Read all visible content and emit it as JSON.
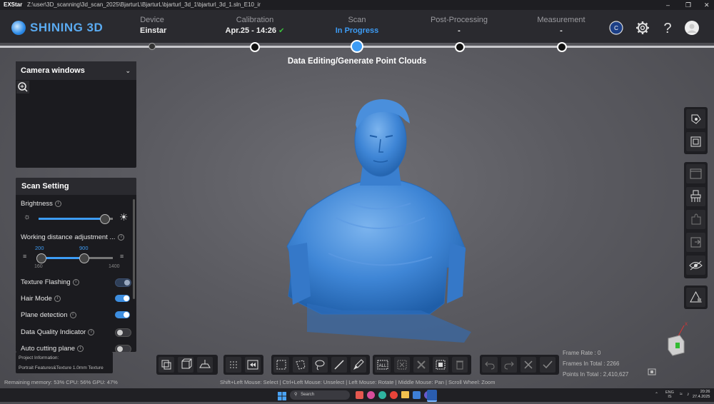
{
  "titlebar": {
    "app": "EXStar",
    "path": "Z:\\user\\3D_scanning\\3d_scan_2025\\BjarturL\\BjarturL\\bjarturl_3d_1\\bjarturl_3d_1.sln_E10_ir"
  },
  "brand": {
    "name": "SHINING 3D",
    "color": "#5aaaf0"
  },
  "steps": [
    {
      "label": "Device",
      "value": "Einstar"
    },
    {
      "label": "Calibration",
      "value": "Apr.25 - 14:26"
    },
    {
      "label": "Scan",
      "value": "In Progress"
    },
    {
      "label": "Post-Processing",
      "value": "-"
    },
    {
      "label": "Measurement",
      "value": "-"
    }
  ],
  "banner": "Data Editing/Generate Point Clouds",
  "camera_windows": {
    "title": "Camera windows"
  },
  "scan_setting": {
    "title": "Scan Setting",
    "brightness_label": "Brightness",
    "brightness_level": 0.88,
    "working_distance_label": "Working distance adjustment ...",
    "wd_low": "200",
    "wd_high": "900",
    "wd_min": "160",
    "wd_max": "1400",
    "texture_flashing": {
      "label": "Texture Flashing",
      "on": false
    },
    "hair_mode": {
      "label": "Hair Mode",
      "on": true
    },
    "plane_detection": {
      "label": "Plane detection",
      "on": true
    },
    "data_quality": {
      "label": "Data Quality Indicator",
      "on": false
    },
    "auto_cutting": {
      "label": "Auto cutting plane",
      "on": false
    }
  },
  "project_info": {
    "title": "Project Information:",
    "details": "Portrait  Features&Texture  1.0mm  Texture"
  },
  "stats": {
    "frame_rate": "Frame Rate : 0",
    "frames_total": "Frames In Total : 2266",
    "points_total": "Points In Total : 2,410,627"
  },
  "status": {
    "memory": "Remaining memory: 53% CPU: 56% GPU: 47%",
    "hints": "Shift+Left Mouse: Select | Ctrl+Left Mouse: Unselect | Left Mouse: Rotate | Middle Mouse: Pan | Scroll Wheel: Zoom"
  },
  "taskbar": {
    "search": "Search",
    "lang": "ENG",
    "lang2": "IS",
    "time": "20:26",
    "date": "27.4.2025"
  },
  "colors": {
    "accent": "#3d9cf5",
    "scan_model": "#3f86d6"
  }
}
